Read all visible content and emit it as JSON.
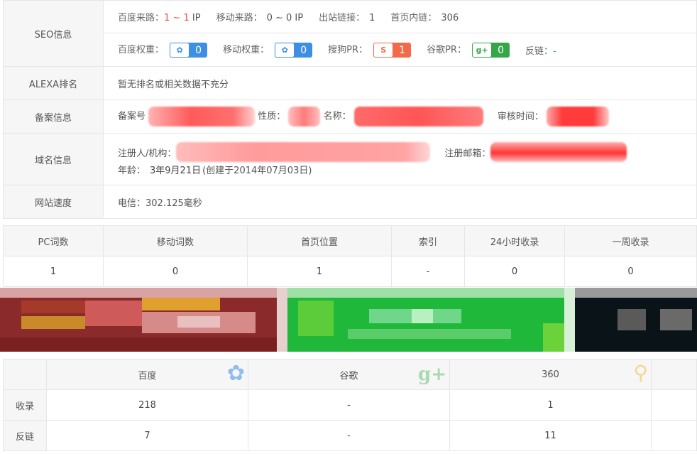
{
  "seo": {
    "label": "SEO信息",
    "baidu_source_label": "百度来路：",
    "baidu_source_from": "1",
    "baidu_source_sep": " ~ ",
    "baidu_source_to": "1",
    "baidu_source_unit": " IP",
    "mobile_source_label": "移动来路：",
    "mobile_source_value": "0 ~ 0 IP",
    "outbound_label": "出站链接：",
    "outbound_value": "1",
    "inbound_label": "首页内链：",
    "inbound_value": "306",
    "baidu_weight_label": "百度权重：",
    "baidu_weight_value": "0",
    "mobile_weight_label": "移动权重：",
    "mobile_weight_value": "0",
    "sogou_pr_label": "搜狗PR：",
    "sogou_pr_value": "1",
    "google_pr_label": "谷歌PR：",
    "google_pr_value": "0",
    "backlink_label": "反链：",
    "backlink_value": "-",
    "colors": {
      "baidu_blue": "#3d8fe6",
      "sogou_orange": "#f26a4a",
      "google_green": "#35a54a",
      "red_text": "#f04d3a"
    }
  },
  "alexa": {
    "label": "ALEXA排名",
    "value": "暂无排名或相关数据不充分"
  },
  "icp": {
    "label": "备案信息",
    "number_label": "备案号",
    "nature_label": "性质：",
    "name_label": "名称：",
    "review_label": "审核时间："
  },
  "domain": {
    "label": "域名信息",
    "registrant_label": "注册人/机构：",
    "email_label": "注册邮箱：",
    "age_label": "年龄：",
    "age_value": "3年9月21日",
    "created": "(创建于2014年07月03日)"
  },
  "speed": {
    "label": "网站速度",
    "value": "电信：302.125毫秒"
  },
  "ranking": {
    "headers": [
      "PC词数",
      "移动词数",
      "首页位置",
      "索引",
      "24小时收录",
      "一周收录"
    ],
    "values": [
      "1",
      "0",
      "1",
      "-",
      "0",
      "0"
    ]
  },
  "engines": {
    "headers": [
      "百度",
      "谷歌",
      "360"
    ],
    "icons": [
      "paw-icon",
      "google-plus-icon",
      "search-360-icon"
    ],
    "rows": [
      {
        "label": "收录",
        "values": [
          "218",
          "-",
          "1"
        ]
      },
      {
        "label": "反链",
        "values": [
          "7",
          "-",
          "11"
        ]
      }
    ]
  }
}
